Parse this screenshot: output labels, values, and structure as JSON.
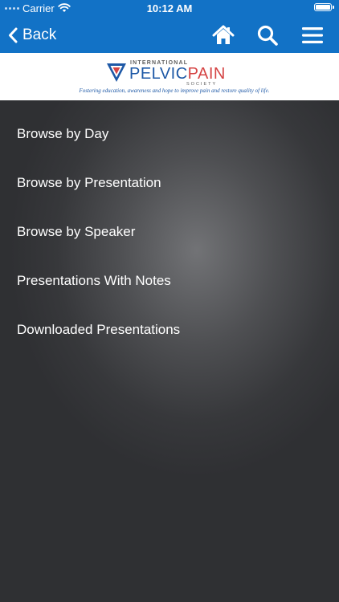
{
  "status_bar": {
    "carrier": "Carrier",
    "time": "10:12 AM"
  },
  "nav": {
    "back_label": "Back",
    "icons": [
      "home-icon",
      "search-icon",
      "menu-icon"
    ]
  },
  "banner": {
    "logo": {
      "international": "INTERNATIONAL",
      "pelvic": "PELVIC",
      "pain": "PAIN",
      "society": "SOCIETY",
      "tagline": "Fostering education, awareness and hope to improve pain and restore quality of life."
    }
  },
  "menu": {
    "items": [
      {
        "label": "Browse by Day"
      },
      {
        "label": "Browse by Presentation"
      },
      {
        "label": "Browse by Speaker"
      },
      {
        "label": "Presentations With Notes"
      },
      {
        "label": "Downloaded Presentations"
      }
    ]
  },
  "colors": {
    "nav_blue": "#1272c6",
    "logo_blue": "#1d58a6",
    "logo_red": "#d54444",
    "background": "#2f3034"
  }
}
